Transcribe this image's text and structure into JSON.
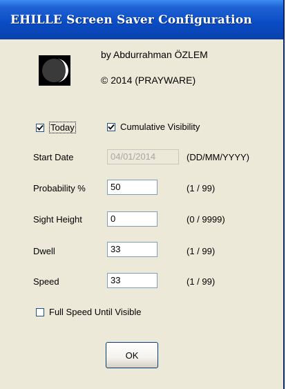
{
  "window": {
    "title": "EHILLE Screen Saver Configuration"
  },
  "about": {
    "author": "by Abdurrahman ÖZLEM",
    "copyright": "© 2014  (PRAYWARE)",
    "logo_icon": "moon-icon"
  },
  "options": {
    "today": {
      "label": "Today",
      "checked": true
    },
    "cumulative": {
      "label": "Cumulative Visibility",
      "checked": true
    },
    "full_speed": {
      "label": "Full Speed Until Visible",
      "checked": false
    }
  },
  "fields": [
    {
      "label": "Start Date",
      "value": "04/01/2014",
      "hint": "(DD/MM/YYYY)",
      "disabled": true
    },
    {
      "label": "Probability %",
      "value": "50",
      "hint": "(1 / 99)",
      "disabled": false
    },
    {
      "label": "Sight Height",
      "value": "0",
      "hint": "(0 / 9999)",
      "disabled": false
    },
    {
      "label": "Dwell",
      "value": "33",
      "hint": "(1 / 99)",
      "disabled": false
    },
    {
      "label": "Speed",
      "value": "33",
      "hint": "(1 / 99)",
      "disabled": false
    }
  ],
  "buttons": {
    "ok": "OK"
  },
  "colors": {
    "titlebar": "#0a4bc4",
    "dialog_bg": "#ece9d8",
    "field_border": "#7f9db9"
  }
}
